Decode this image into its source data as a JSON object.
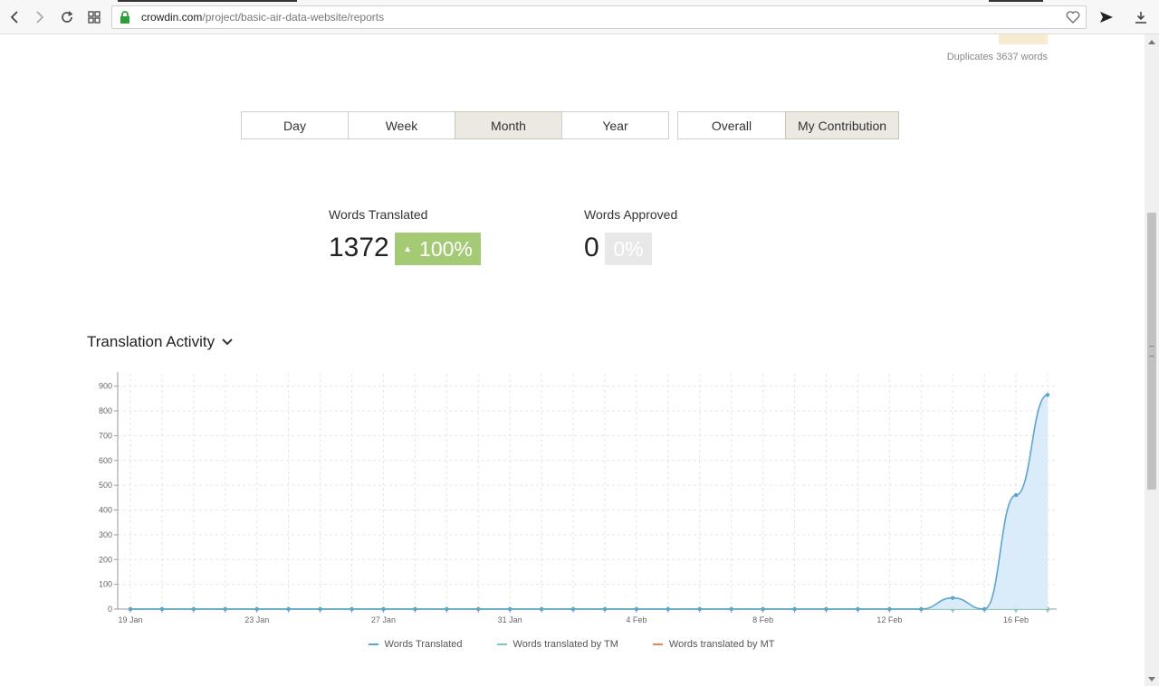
{
  "browser": {
    "url_host": "crowdin.com",
    "url_path": "/project/basic-air-data-website/reports",
    "icons": [
      "back-icon",
      "forward-icon",
      "reload-icon",
      "tabs-grid-icon",
      "lock-icon",
      "heart-icon",
      "flag-icon",
      "download-icon"
    ]
  },
  "duplicates": {
    "text": "Duplicates 3637 words",
    "color": "#f6ebcf"
  },
  "period_tabs": [
    {
      "label": "Day",
      "active": false
    },
    {
      "label": "Week",
      "active": false
    },
    {
      "label": "Month",
      "active": true
    },
    {
      "label": "Year",
      "active": false
    }
  ],
  "scope_tabs": [
    {
      "label": "Overall",
      "active": false
    },
    {
      "label": "My Contribution",
      "active": true
    }
  ],
  "stats": {
    "translated": {
      "label": "Words Translated",
      "value": "1372",
      "change": "100%",
      "color": "#a5ca76"
    },
    "approved": {
      "label": "Words Approved",
      "value": "0",
      "change": "0%",
      "color": "#e8e8e8"
    }
  },
  "section": {
    "title": "Translation Activity"
  },
  "chart_data": {
    "type": "area",
    "x": [
      "19 Jan",
      "20 Jan",
      "21 Jan",
      "22 Jan",
      "23 Jan",
      "24 Jan",
      "25 Jan",
      "26 Jan",
      "27 Jan",
      "28 Jan",
      "29 Jan",
      "30 Jan",
      "31 Jan",
      "1 Feb",
      "2 Feb",
      "3 Feb",
      "4 Feb",
      "5 Feb",
      "6 Feb",
      "7 Feb",
      "8 Feb",
      "9 Feb",
      "10 Feb",
      "11 Feb",
      "12 Feb",
      "13 Feb",
      "14 Feb",
      "15 Feb",
      "16 Feb",
      "17 Feb"
    ],
    "x_tick_labels": [
      "19 Jan",
      "23 Jan",
      "27 Jan",
      "31 Jan",
      "4 Feb",
      "8 Feb",
      "12 Feb",
      "16 Feb"
    ],
    "y_ticks": [
      0,
      100,
      200,
      300,
      400,
      500,
      600,
      700,
      800,
      900
    ],
    "ylim": [
      0,
      950
    ],
    "grid": true,
    "legend_position": "bottom",
    "series": [
      {
        "name": "Words Translated",
        "color": "#5aa6cf",
        "values": [
          0,
          0,
          0,
          0,
          0,
          0,
          0,
          0,
          0,
          0,
          0,
          0,
          0,
          0,
          0,
          0,
          0,
          0,
          0,
          0,
          0,
          0,
          0,
          0,
          0,
          0,
          45,
          0,
          460,
          865
        ]
      },
      {
        "name": "Words translated by TM",
        "color": "#7fc9c0",
        "values": [
          0,
          0,
          0,
          0,
          0,
          0,
          0,
          0,
          0,
          0,
          0,
          0,
          0,
          0,
          0,
          0,
          0,
          0,
          0,
          0,
          0,
          0,
          0,
          0,
          0,
          0,
          0,
          0,
          0,
          0
        ]
      },
      {
        "name": "Words translated by MT",
        "color": "#e08a5a",
        "values": [
          0,
          0,
          0,
          0,
          0,
          0,
          0,
          0,
          0,
          0,
          0,
          0,
          0,
          0,
          0,
          0,
          0,
          0,
          0,
          0,
          0,
          0,
          0,
          0,
          0,
          0,
          0,
          0,
          0,
          0
        ]
      }
    ]
  }
}
